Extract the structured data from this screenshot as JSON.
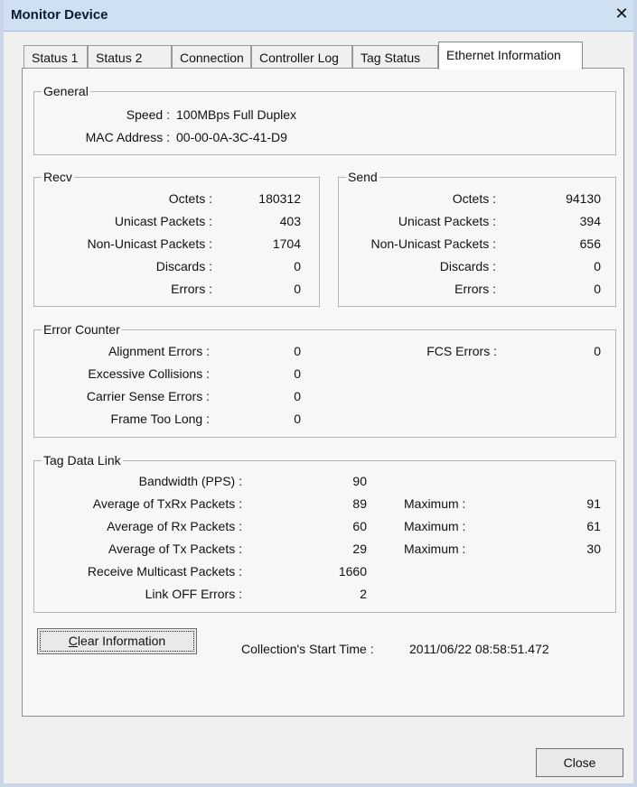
{
  "window": {
    "title": "Monitor Device",
    "close_glyph": "✕"
  },
  "tabs": [
    "Status 1",
    "Status 2",
    "Connection",
    "Controller Log",
    "Tag Status",
    "Ethernet Information"
  ],
  "active_tab": "Ethernet Information",
  "general": {
    "legend": "General",
    "speed_label": "Speed :",
    "speed_value": "100MBps Full Duplex",
    "mac_label": "MAC Address :",
    "mac_value": "00-00-0A-3C-41-D9"
  },
  "recv": {
    "legend": "Recv",
    "rows": [
      {
        "label": "Octets :",
        "value": "180312"
      },
      {
        "label": "Unicast Packets :",
        "value": "403"
      },
      {
        "label": "Non-Unicast Packets :",
        "value": "1704"
      },
      {
        "label": "Discards :",
        "value": "0"
      },
      {
        "label": "Errors :",
        "value": "0"
      }
    ]
  },
  "send": {
    "legend": "Send",
    "rows": [
      {
        "label": "Octets :",
        "value": "94130"
      },
      {
        "label": "Unicast Packets :",
        "value": "394"
      },
      {
        "label": "Non-Unicast Packets :",
        "value": "656"
      },
      {
        "label": "Discards :",
        "value": "0"
      },
      {
        "label": "Errors :",
        "value": "0"
      }
    ]
  },
  "error_counter": {
    "legend": "Error Counter",
    "rows": [
      {
        "label": "Alignment Errors :",
        "value": "0"
      },
      {
        "label": "Excessive Collisions :",
        "value": "0"
      },
      {
        "label": "Carrier Sense Errors :",
        "value": "0"
      },
      {
        "label": "Frame Too Long :",
        "value": "0"
      }
    ],
    "fcs_label": "FCS Errors :",
    "fcs_value": "0"
  },
  "tag_data_link": {
    "legend": "Tag Data Link",
    "rows": [
      {
        "label": "Bandwidth (PPS) :",
        "value": "90"
      },
      {
        "label": "Average of TxRx Packets :",
        "value": "89",
        "max_label": "Maximum :",
        "max_value": "91"
      },
      {
        "label": "Average of Rx Packets :",
        "value": "60",
        "max_label": "Maximum :",
        "max_value": "61"
      },
      {
        "label": "Average of Tx Packets :",
        "value": "29",
        "max_label": "Maximum :",
        "max_value": "30"
      },
      {
        "label": "Receive Multicast Packets :",
        "value": "1660"
      },
      {
        "label": "Link OFF Errors :",
        "value": "2"
      }
    ]
  },
  "clear_button": {
    "label_underlined": "C",
    "label_rest": "lear Information"
  },
  "collection_start": {
    "label": "Collection's Start Time :",
    "value": "2011/06/22 08:58:51.472"
  },
  "close_button": {
    "label": "Close"
  }
}
